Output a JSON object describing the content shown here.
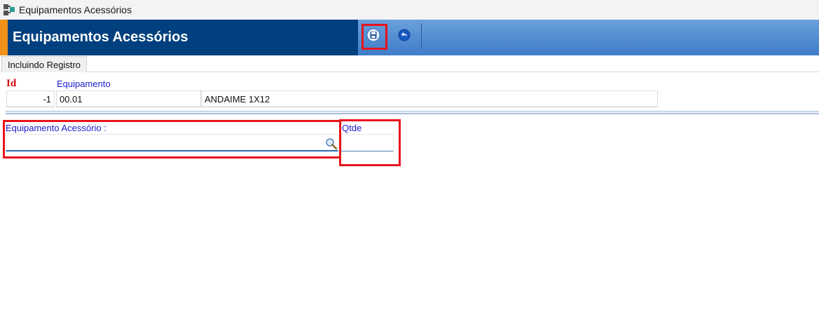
{
  "window": {
    "title": "Equipamentos Acessórios"
  },
  "header": {
    "title": "Equipamentos Acessórios",
    "toolbar": {
      "save": "save-icon",
      "back": "undo-icon"
    }
  },
  "tab": {
    "label": "Incluindo Registro"
  },
  "form": {
    "id_label": "Id",
    "id_value": "-1",
    "equipamento_label": "Equipamento",
    "equipamento_code": "00.01",
    "equipamento_desc": "ANDAIME 1X12",
    "acessorio_label": "Equipamento Acessório :",
    "acessorio_value": "",
    "qtde_label": "Qtde",
    "qtde_value": ""
  },
  "colors": {
    "header_dark": "#00407e",
    "header_gradient": "#3f7cc8",
    "accent_orange": "#f29118",
    "label_blue": "#1b1bd0",
    "id_red": "#d4000c",
    "highlight_red": "#e8141c"
  }
}
